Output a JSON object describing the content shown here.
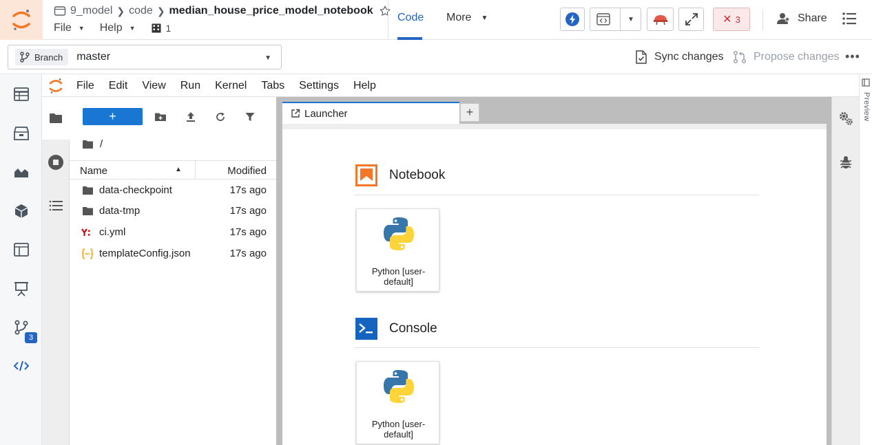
{
  "header": {
    "breadcrumb": [
      "9_model",
      "code"
    ],
    "notebook_title": "median_house_price_model_notebook",
    "menu": [
      "File",
      "Help"
    ],
    "resource_count": "1",
    "tabs": {
      "code": "Code",
      "more": "More"
    },
    "error_count": "3",
    "share_label": "Share"
  },
  "branchbar": {
    "chip_label": "Branch",
    "branch_name": "master",
    "sync_label": "Sync changes",
    "propose_label": "Propose changes"
  },
  "leftnav": {
    "icons": [
      "table-icon",
      "archive-icon",
      "area-chart-icon",
      "cube-icon",
      "layout-icon",
      "presentation-icon",
      "git-branch-icon",
      "code-icon"
    ],
    "badge": "3"
  },
  "jupyter": {
    "menu": [
      "File",
      "Edit",
      "View",
      "Run",
      "Kernel",
      "Tabs",
      "Settings",
      "Help"
    ],
    "filebrowser": {
      "path": "/",
      "columns": {
        "name": "Name",
        "modified": "Modified"
      },
      "files": [
        {
          "name": "data-checkpoint",
          "modified": "17s ago",
          "type": "folder"
        },
        {
          "name": "data-tmp",
          "modified": "17s ago",
          "type": "folder"
        },
        {
          "name": "ci.yml",
          "modified": "17s ago",
          "type": "yaml"
        },
        {
          "name": "templateConfig.json",
          "modified": "17s ago",
          "type": "json"
        }
      ]
    },
    "launcher": {
      "tab_label": "Launcher",
      "sections": [
        {
          "title": "Notebook",
          "card_line1": "Python [user-",
          "card_line2": "default]"
        },
        {
          "title": "Console",
          "card_line1": "Python [user-",
          "card_line2": "default]"
        }
      ]
    },
    "right_rail_label": "Preview"
  },
  "colors": {
    "accent": "#2465c4",
    "jupyter_blue": "#1976d2",
    "jupyter_orange": "#f37726",
    "error_red": "#c9303a"
  }
}
